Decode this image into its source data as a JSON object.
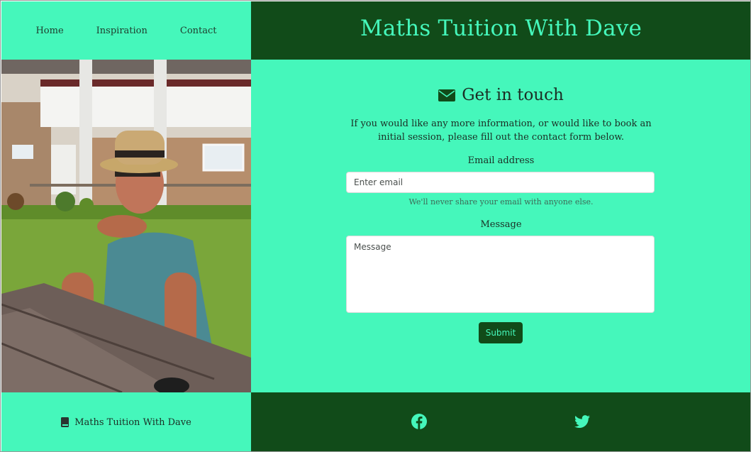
{
  "nav": {
    "items": [
      "Home",
      "Inspiration",
      "Contact"
    ]
  },
  "site": {
    "title": "Maths Tuition With Dave"
  },
  "contact": {
    "heading": "Get in touch",
    "intro": "If you would like any more information, or would like to book an initial session, please fill out the contact form below.",
    "email_label": "Email address",
    "email_placeholder": "Enter email",
    "email_help": "We'll never share your email with anyone else.",
    "message_label": "Message",
    "message_placeholder": "Message",
    "submit_label": "Submit"
  },
  "footer": {
    "brand": "Maths Tuition With Dave",
    "icons": [
      "book-icon",
      "facebook-icon",
      "twitter-icon"
    ]
  },
  "colors": {
    "accent": "#45f7bb",
    "dark": "#114b19"
  }
}
